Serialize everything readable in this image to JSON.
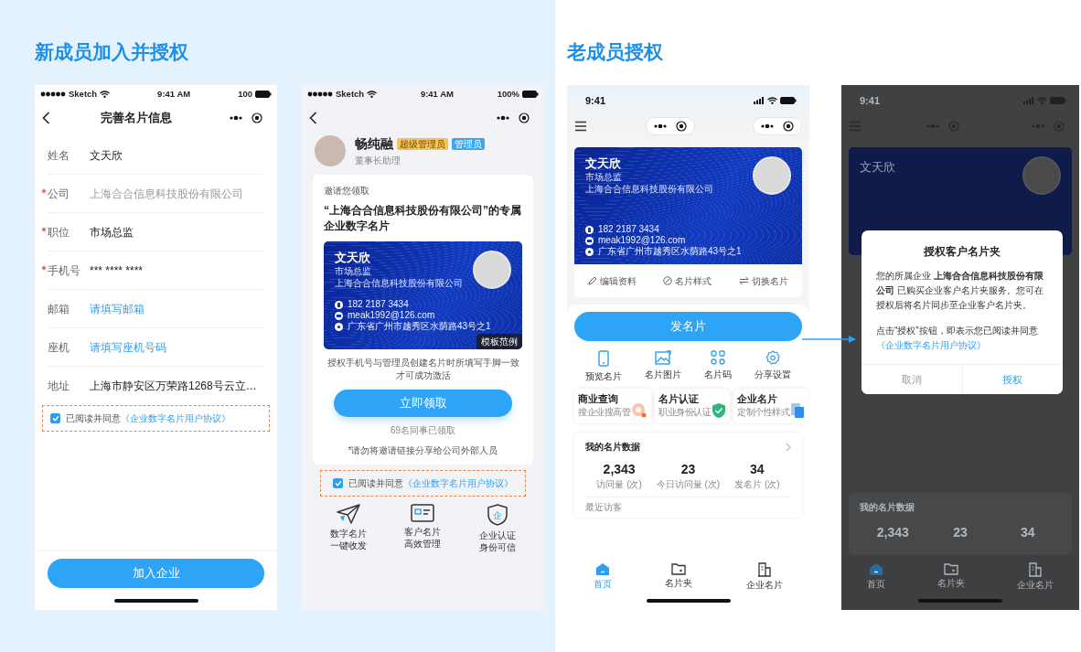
{
  "left": {
    "title": "新成员加入并授权",
    "form_screen": {
      "status": {
        "carrier": "Sketch",
        "time": "9:41 AM",
        "battery": "100"
      },
      "nav_title": "完善名片信息",
      "fields": [
        {
          "label": "姓名",
          "required": false,
          "readonly": false,
          "value": "文天欣"
        },
        {
          "label": "公司",
          "required": true,
          "readonly": true,
          "value": "上海合合信息科技股份有限公司"
        },
        {
          "label": "职位",
          "required": true,
          "readonly": false,
          "value": "市场总监"
        },
        {
          "label": "手机号",
          "required": true,
          "readonly": false,
          "value": "*** **** ****"
        },
        {
          "label": "邮箱",
          "required": false,
          "readonly": false,
          "placeholder": "请填写邮箱"
        },
        {
          "label": "座机",
          "required": false,
          "readonly": false,
          "placeholder": "请填写座机号码"
        },
        {
          "label": "地址",
          "required": false,
          "readonly": false,
          "value": "上海市静安区万荣路1268号云立…"
        }
      ],
      "agreement": {
        "checked": true,
        "text": "已阅读并同意",
        "link": "《企业数字名片用户协议》"
      },
      "button": "加入企业"
    },
    "invite_screen": {
      "status": {
        "carrier": "Sketch",
        "time": "9:41 AM",
        "battery": "100%"
      },
      "profile": {
        "name": "畅纯融",
        "badges": [
          {
            "text": "超级管理员",
            "color": "#f4c35c"
          },
          {
            "text": "管理员",
            "color": "#3ea6f2"
          }
        ],
        "subtitle": "董事长助理"
      },
      "invite_label": "邀请您领取",
      "headline": "“上海合合信息科技股份有限公司”的专属企业数字名片",
      "card": {
        "name": "文天欣",
        "title": "市场总监",
        "company": "上海合合信息科技股份有限公司",
        "contacts": [
          {
            "kind": "phone",
            "text": "182 2187 3434"
          },
          {
            "kind": "email",
            "text": "meak1992@126.com"
          },
          {
            "kind": "address",
            "text": "广东省广州市越秀区水荫路43号之1"
          }
        ],
        "tag": "模板范例"
      },
      "note": "授权手机号与管理员创建名片时所填写手脚一致才可成功激活",
      "button": "立即领取",
      "count": "69名同事已领取",
      "warning": "*请勿将邀请链接分享给公司外部人员",
      "agreement": {
        "checked": true,
        "text": "已阅读并同意",
        "link": "《企业数字名片用户协议》"
      },
      "features": [
        {
          "kind": "send",
          "lines": [
            "数字名片",
            "一键收发"
          ]
        },
        {
          "kind": "card",
          "lines": [
            "客户名片",
            "高效管理"
          ]
        },
        {
          "kind": "shield",
          "icon_text": "企",
          "lines": [
            "企业认证",
            "身份可信"
          ]
        }
      ]
    }
  },
  "right": {
    "title": "老成员授权",
    "home_screen": {
      "status": {
        "time": "9:41"
      },
      "card": {
        "name": "文天欣",
        "title": "市场总监",
        "company": "上海合合信息科技股份有限公司",
        "contacts": [
          {
            "kind": "phone",
            "text": "182 2187 3434"
          },
          {
            "kind": "email",
            "text": "meak1992@126.com"
          },
          {
            "kind": "address",
            "text": "广东省广州市越秀区水荫路43号之1"
          }
        ]
      },
      "card_actions": [
        {
          "kind": "edit",
          "label": "编辑资料"
        },
        {
          "kind": "style",
          "label": "名片样式"
        },
        {
          "kind": "switch",
          "label": "切换名片"
        }
      ],
      "main_button": "发名片",
      "quick_actions": [
        {
          "kind": "preview",
          "label": "预览名片"
        },
        {
          "kind": "image",
          "label": "名片图片"
        },
        {
          "kind": "qrcode",
          "label": "名片码"
        },
        {
          "kind": "settings",
          "label": "分享设置"
        }
      ],
      "tiles": [
        {
          "kind": "search",
          "title": "商业查询",
          "subtitle": "搜企业搜高管"
        },
        {
          "kind": "verify",
          "title": "名片认证",
          "subtitle": "职业身份认证"
        },
        {
          "kind": "company",
          "title": "企业名片",
          "subtitle": "定制个性样式"
        }
      ],
      "data": {
        "title": "我的名片数据",
        "stats": [
          {
            "value": "2,343",
            "label": "访问量 (次)"
          },
          {
            "value": "23",
            "label": "今日访问量 (次)"
          },
          {
            "value": "34",
            "label": "发名片 (次)"
          }
        ],
        "recent": "最近访客"
      },
      "tabs": [
        {
          "kind": "home",
          "label": "首页",
          "selected": true
        },
        {
          "kind": "folder",
          "label": "名片夹",
          "selected": false
        },
        {
          "kind": "building",
          "label": "企业名片",
          "selected": false
        }
      ]
    },
    "dialog_screen": {
      "backdrop": {
        "time": "9:41",
        "card_name": "文天欣",
        "data_title": "我的名片数据",
        "stats": [
          "2,343",
          "23",
          "34"
        ],
        "tabs": [
          {
            "kind": "home",
            "label": "首页"
          },
          {
            "kind": "folder",
            "label": "名片夹"
          },
          {
            "kind": "building",
            "label": "企业名片"
          }
        ]
      },
      "dialog": {
        "title": "授权客户名片夹",
        "body": "您的所属企业 **上海合合信息科技股份有限公司** 已购买企业客户名片夹服务。您可在授权后将名片同步至企业客户名片夹。",
        "consent": "点击“授权”按钮，即表示您已阅读并同意",
        "link": "《企业数字名片用户协议》",
        "buttons": [
          {
            "kind": "cancel",
            "label": "取消"
          },
          {
            "kind": "confirm",
            "label": "授权"
          }
        ]
      }
    }
  }
}
